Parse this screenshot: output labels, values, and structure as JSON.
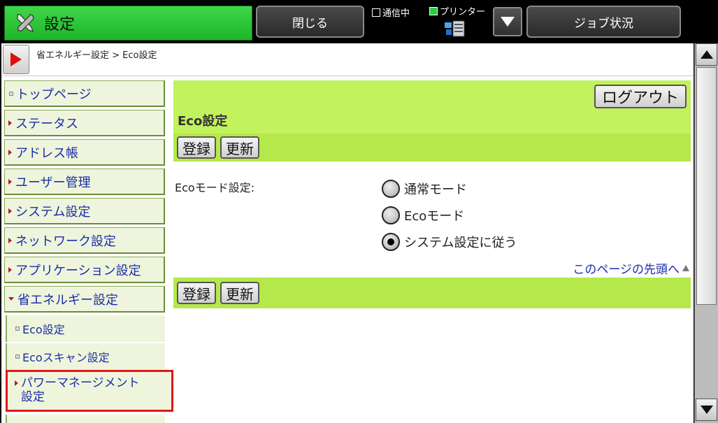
{
  "topbar": {
    "title": "設定",
    "close_label": "閉じる",
    "status_comm": "通信中",
    "status_printer": "プリンター",
    "job_label": "ジョブ状況"
  },
  "breadcrumb": {
    "text": "省エネルギー設定 > Eco設定"
  },
  "sidebar": {
    "items": [
      {
        "label": "トップページ"
      },
      {
        "label": "ステータス"
      },
      {
        "label": "アドレス帳"
      },
      {
        "label": "ユーザー管理"
      },
      {
        "label": "システム設定"
      },
      {
        "label": "ネットワーク設定"
      },
      {
        "label": "アプリケーション設定"
      },
      {
        "label": "省エネルギー設定"
      }
    ],
    "sub_items": [
      {
        "label": "Eco設定"
      },
      {
        "label": "Ecoスキャン設定"
      },
      {
        "label_line1": "パワーマネージメント",
        "label_line2": "設定"
      }
    ]
  },
  "panel": {
    "logout_label": "ログアウト",
    "title": "Eco設定",
    "register_label": "登録",
    "update_label": "更新",
    "eco_mode_label": "Ecoモード設定:",
    "options": [
      {
        "label": "通常モード",
        "checked": false
      },
      {
        "label": "Ecoモード",
        "checked": false
      },
      {
        "label": "システム設定に従う",
        "checked": true
      }
    ],
    "top_link": "このページの先頭へ"
  },
  "colors": {
    "accent_green": "#1fb52b",
    "panel_green": "#c2f25c",
    "link_blue": "#1a2ea8",
    "highlight_red": "#e01818"
  }
}
